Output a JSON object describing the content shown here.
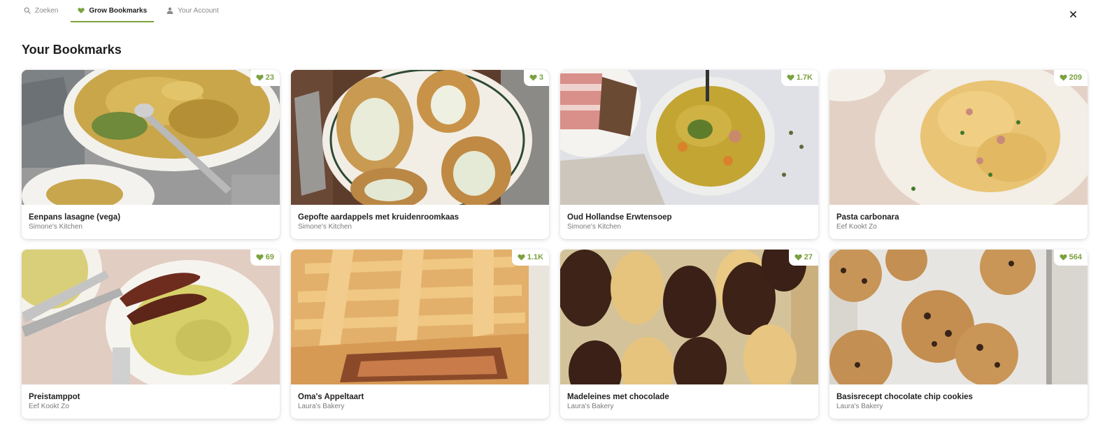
{
  "nav": {
    "tabs": [
      {
        "label": "Zoeken",
        "icon": "search-icon"
      },
      {
        "label": "Grow Bookmarks",
        "icon": "heart-icon"
      },
      {
        "label": "Your Account",
        "icon": "user-icon"
      }
    ],
    "close_icon": "close-icon"
  },
  "page": {
    "title": "Your Bookmarks"
  },
  "accent_color": "#7ba13f",
  "cards": [
    {
      "title": "Eenpans lasagne (vega)",
      "author": "Simone's Kitchen",
      "likes": "23"
    },
    {
      "title": "Gepofte aardappels met kruidenroomkaas",
      "author": "Simone's Kitchen",
      "likes": "3"
    },
    {
      "title": "Oud Hollandse Erwtensoep",
      "author": "Simone's Kitchen",
      "likes": "1.7K"
    },
    {
      "title": "Pasta carbonara",
      "author": "Eef Kookt Zo",
      "likes": "209"
    },
    {
      "title": "Preistamppot",
      "author": "Eef Kookt Zo",
      "likes": "69"
    },
    {
      "title": "Oma's Appeltaart",
      "author": "Laura's Bakery",
      "likes": "1.1K"
    },
    {
      "title": "Madeleines met chocolade",
      "author": "Laura's Bakery",
      "likes": "27"
    },
    {
      "title": "Basisrecept chocolate chip cookies",
      "author": "Laura's Bakery",
      "likes": "564"
    }
  ]
}
